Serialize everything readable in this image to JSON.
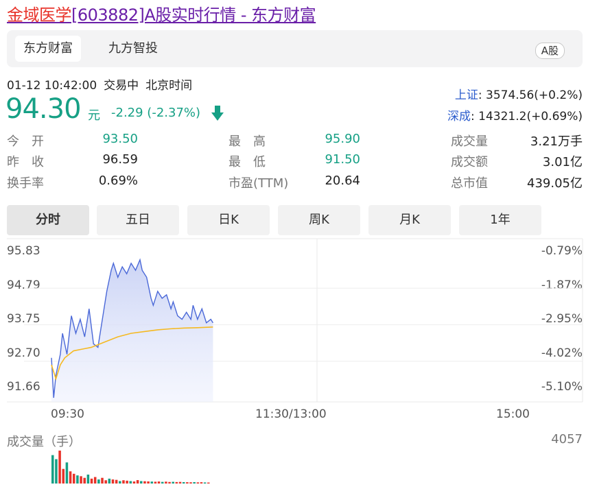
{
  "page": {
    "title_part1": "金域医学",
    "title_part2": "[603882]A股实时行情 - 东方财富"
  },
  "tabs": [
    {
      "label": "东方财富",
      "active": true
    },
    {
      "label": "九方智投",
      "active": false
    }
  ],
  "market_badge": "A股",
  "quote": {
    "datetime": "01-12 10:42:00",
    "status": "交易中",
    "timezone": "北京时间",
    "price": "94.30",
    "unit": "元",
    "change": "-2.29 (-2.37%)"
  },
  "indices": [
    {
      "name": "上证",
      "value": "3574.56(+0.2%)"
    },
    {
      "name": "深成",
      "value": "14321.2(+0.69%)"
    }
  ],
  "stats": {
    "open": {
      "label": "今　开",
      "value": "93.50"
    },
    "prev_close": {
      "label": "昨　收",
      "value": "96.59"
    },
    "turnover_rate": {
      "label": "换手率",
      "value": "0.69%"
    },
    "high": {
      "label": "最　高",
      "value": "95.90"
    },
    "low": {
      "label": "最　低",
      "value": "91.50"
    },
    "pe": {
      "label": "市盈(TTM)",
      "value": "20.64"
    },
    "volume": {
      "label": "成交量",
      "value": "3.21万手"
    },
    "amount": {
      "label": "成交额",
      "value": "3.01亿"
    },
    "market_cap": {
      "label": "总市值",
      "value": "439.05亿"
    }
  },
  "chart_tabs": [
    {
      "label": "分时",
      "active": true
    },
    {
      "label": "五日",
      "active": false
    },
    {
      "label": "日K",
      "active": false
    },
    {
      "label": "周K",
      "active": false
    },
    {
      "label": "月K",
      "active": false
    },
    {
      "label": "1年",
      "active": false
    }
  ],
  "colors": {
    "up": "#e8332a",
    "down": "#16a085",
    "price_line": "#4a68d8",
    "avg_line": "#f5b921",
    "index_link": "#2c5dcd"
  },
  "chart_data": {
    "type": "line",
    "y_ticks_left": [
      "95.83",
      "94.79",
      "93.75",
      "92.70",
      "91.66"
    ],
    "y_ticks_right": [
      "-0.79%",
      "-1.87%",
      "-2.95%",
      "-4.02%",
      "-5.10%"
    ],
    "x_ticks": [
      "09:30",
      "11:30/13:00",
      "15:00"
    ],
    "ylim": [
      91.66,
      95.83
    ],
    "x_range_minutes": [
      0,
      240
    ],
    "series": [
      {
        "x": [
          0,
          1,
          2,
          4,
          5,
          7,
          9,
          11,
          13,
          15,
          16,
          17,
          19,
          21,
          23,
          25,
          27,
          28,
          30,
          32,
          34,
          36,
          38,
          40,
          41,
          43,
          45,
          46,
          48,
          50,
          52,
          54,
          55,
          57,
          59,
          61,
          63,
          64,
          66,
          68,
          70,
          72,
          73
        ],
        "values": [
          92.8,
          91.66,
          92.3,
          92.9,
          93.5,
          92.9,
          94.0,
          93.5,
          93.9,
          93.4,
          93.8,
          94.2,
          93.2,
          93.1,
          93.9,
          94.7,
          95.3,
          95.5,
          95.1,
          95.4,
          95.2,
          95.5,
          95.3,
          95.6,
          95.3,
          95.1,
          94.5,
          94.3,
          94.7,
          94.5,
          94.6,
          94.2,
          94.4,
          94.0,
          93.9,
          94.1,
          93.9,
          94.3,
          93.9,
          94.2,
          93.8,
          93.9,
          93.8
        ]
      },
      {
        "x": [
          0,
          2,
          4,
          6,
          8,
          10,
          14,
          18,
          24,
          30,
          36,
          42,
          48,
          54,
          60,
          66,
          73
        ],
        "values": [
          92.6,
          92.2,
          92.6,
          92.8,
          92.9,
          93.0,
          93.05,
          93.1,
          93.25,
          93.4,
          93.5,
          93.55,
          93.6,
          93.63,
          93.65,
          93.66,
          93.68
        ]
      }
    ],
    "volume": {
      "max_label": "4057",
      "values": [
        3500,
        3000,
        4057,
        1800,
        2600,
        1500,
        1200,
        1000,
        900,
        700,
        1100,
        600,
        800,
        500,
        700,
        400,
        600,
        500,
        450,
        300,
        400,
        350,
        300,
        250,
        420,
        300,
        280,
        260,
        240,
        220,
        250,
        200,
        230,
        190,
        210,
        180,
        200,
        170,
        160,
        150,
        170,
        140,
        160,
        130,
        120
      ]
    }
  }
}
